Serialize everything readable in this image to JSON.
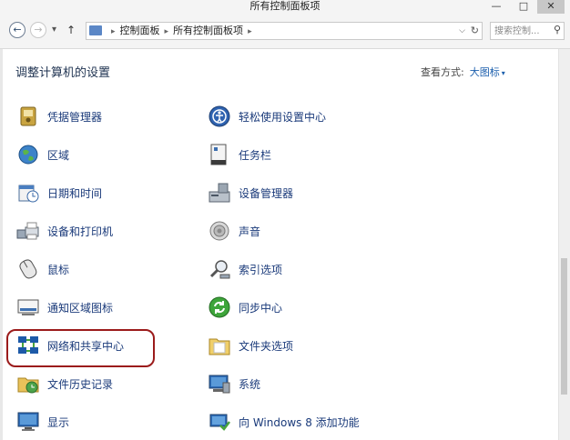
{
  "window": {
    "title": "所有控制面板项",
    "buttons": [
      "—",
      "□",
      "✕"
    ]
  },
  "nav": {
    "back_glyph": "←",
    "forward_glyph": "→",
    "recent_glyph": "▾",
    "up_glyph": "↑",
    "breadcrumbs": [
      "控制面板",
      "所有控制面板项"
    ],
    "breadcrumb_sep": "▸",
    "dropdown_glyph": "⌵",
    "refresh_glyph": "↻",
    "search_placeholder": "搜索控制...",
    "search_glyph": "⚲"
  },
  "main": {
    "heading": "调整计算机的设置",
    "view_by_label": "查看方式:",
    "view_by_value": "大图标",
    "view_by_arrow": "▾"
  },
  "items": {
    "left": [
      {
        "label": "凭据管理器",
        "icon": "credential-manager-icon"
      },
      {
        "label": "区域",
        "icon": "region-globe-icon"
      },
      {
        "label": "日期和时间",
        "icon": "date-time-icon"
      },
      {
        "label": "设备和打印机",
        "icon": "devices-printers-icon"
      },
      {
        "label": "鼠标",
        "icon": "mouse-icon"
      },
      {
        "label": "通知区域图标",
        "icon": "notification-area-icon"
      },
      {
        "label": "网络和共享中心",
        "icon": "network-sharing-icon"
      },
      {
        "label": "文件历史记录",
        "icon": "file-history-icon"
      },
      {
        "label": "显示",
        "icon": "display-icon"
      }
    ],
    "right": [
      {
        "label": "轻松使用设置中心",
        "icon": "ease-of-access-icon"
      },
      {
        "label": "任务栏",
        "icon": "taskbar-icon"
      },
      {
        "label": "设备管理器",
        "icon": "device-manager-icon"
      },
      {
        "label": "声音",
        "icon": "sound-icon"
      },
      {
        "label": "索引选项",
        "icon": "indexing-options-icon"
      },
      {
        "label": "同步中心",
        "icon": "sync-center-icon"
      },
      {
        "label": "文件夹选项",
        "icon": "folder-options-icon"
      },
      {
        "label": "系统",
        "icon": "system-icon"
      },
      {
        "label": "向 Windows 8 添加功能",
        "icon": "add-features-icon"
      }
    ]
  },
  "colors": {
    "link": "#1a3a7a",
    "accent": "#1c5fad",
    "highlight_border": "#9b1b1b"
  }
}
